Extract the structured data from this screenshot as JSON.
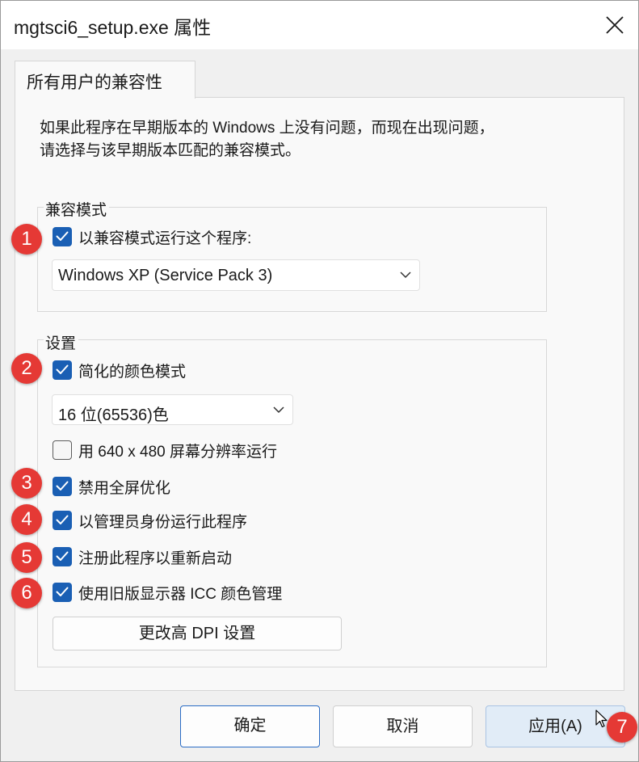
{
  "window": {
    "title": "mgtsci6_setup.exe 属性"
  },
  "tabs": [
    {
      "label": "所有用户的兼容性"
    }
  ],
  "description": {
    "line1": "如果此程序在早期版本的 Windows 上没有问题，而现在出现问题，",
    "line2": "请选择与该早期版本匹配的兼容模式。"
  },
  "compat_mode": {
    "group_label": "兼容模式",
    "checkbox_label": "以兼容模式运行这个程序:",
    "checked": true,
    "selected_os": "Windows XP (Service Pack 3)"
  },
  "settings": {
    "group_label": "设置",
    "reduced_color": {
      "label": "简化的颜色模式",
      "checked": true
    },
    "color_depth": "16 位(65536)色",
    "res_640": {
      "label": "用 640 x 480 屏幕分辨率运行",
      "checked": false
    },
    "disable_fullscreen_opt": {
      "label": "禁用全屏优化",
      "checked": true
    },
    "run_as_admin": {
      "label": "以管理员身份运行此程序",
      "checked": true
    },
    "register_restart": {
      "label": "注册此程序以重新启动",
      "checked": true
    },
    "legacy_icc": {
      "label": "使用旧版显示器 ICC 颜色管理",
      "checked": true
    },
    "dpi_button": "更改高 DPI 设置"
  },
  "footer": {
    "ok": "确定",
    "cancel": "取消",
    "apply": "应用(A)"
  },
  "annotations": [
    "1",
    "2",
    "3",
    "4",
    "5",
    "6",
    "7"
  ],
  "colors": {
    "accent": "#1a5fb4",
    "badge": "#e53935"
  }
}
